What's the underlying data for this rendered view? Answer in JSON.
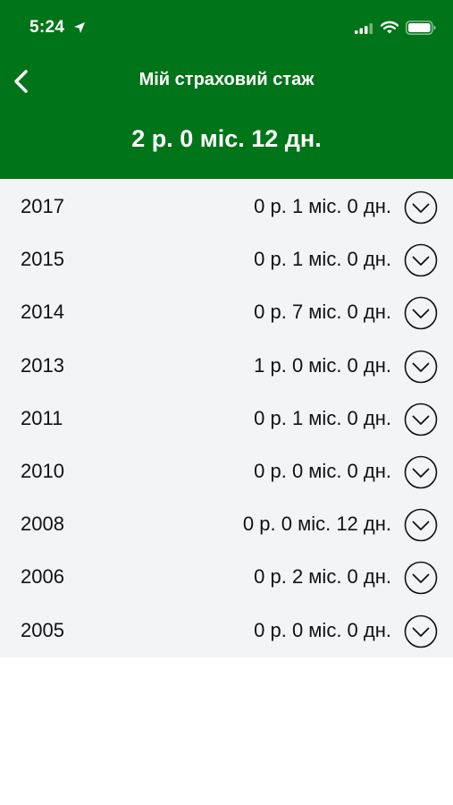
{
  "status_bar": {
    "time": "5:24"
  },
  "header": {
    "title": "Мій страховий стаж",
    "total": "2 р. 0 міс. 12 дн.",
    "background_color": "#007418"
  },
  "list": {
    "rows": [
      {
        "year": "2017",
        "duration": "0 р. 1 міс. 0 дн."
      },
      {
        "year": "2015",
        "duration": "0 р. 1 міс. 0 дн."
      },
      {
        "year": "2014",
        "duration": "0 р. 7 міс. 0 дн."
      },
      {
        "year": "2013",
        "duration": "1 р. 0 міс. 0 дн."
      },
      {
        "year": "2011",
        "duration": "0 р. 1 міс. 0 дн."
      },
      {
        "year": "2010",
        "duration": "0 р. 0 міс. 0 дн."
      },
      {
        "year": "2008",
        "duration": "0 р. 0 міс. 12 дн."
      },
      {
        "year": "2006",
        "duration": "0 р. 2 міс. 0 дн."
      },
      {
        "year": "2005",
        "duration": "0 р. 0 міс. 0 дн."
      }
    ],
    "expand_icon": "chevron-down-circle-icon"
  }
}
